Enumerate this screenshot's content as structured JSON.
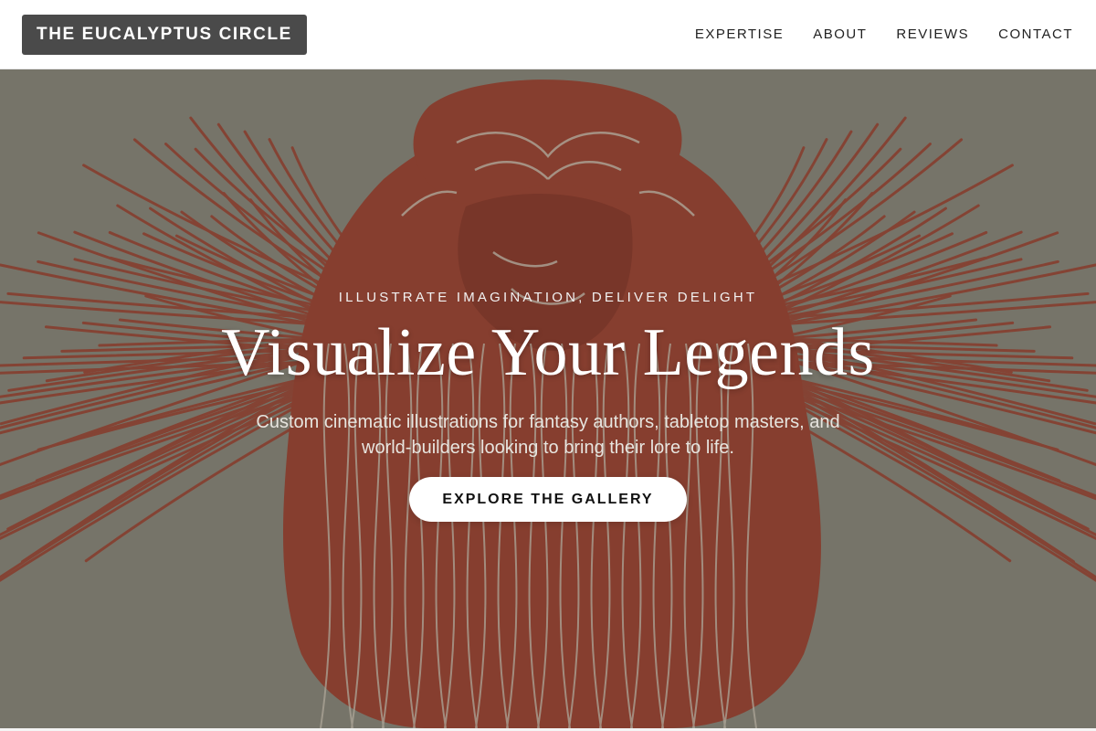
{
  "header": {
    "brand": "THE EUCALYPTUS CIRCLE",
    "nav": [
      "EXPERTISE",
      "ABOUT",
      "REVIEWS",
      "CONTACT"
    ]
  },
  "hero": {
    "tagline": "ILLUSTRATE IMAGINATION, DELIVER DELIGHT",
    "headline": "Visualize Your Legends",
    "subtext": "Custom cinematic illustrations for fantasy authors, tabletop masters, and world-builders looking to bring their lore to life.",
    "cta_label": "EXPLORE THE GALLERY",
    "background_image": "red woodcut-style engraving of winged angel embracing a figure",
    "colors": {
      "background": "#8d8b7e",
      "ink": "#a3402e",
      "line": "#d8d0c0"
    }
  }
}
